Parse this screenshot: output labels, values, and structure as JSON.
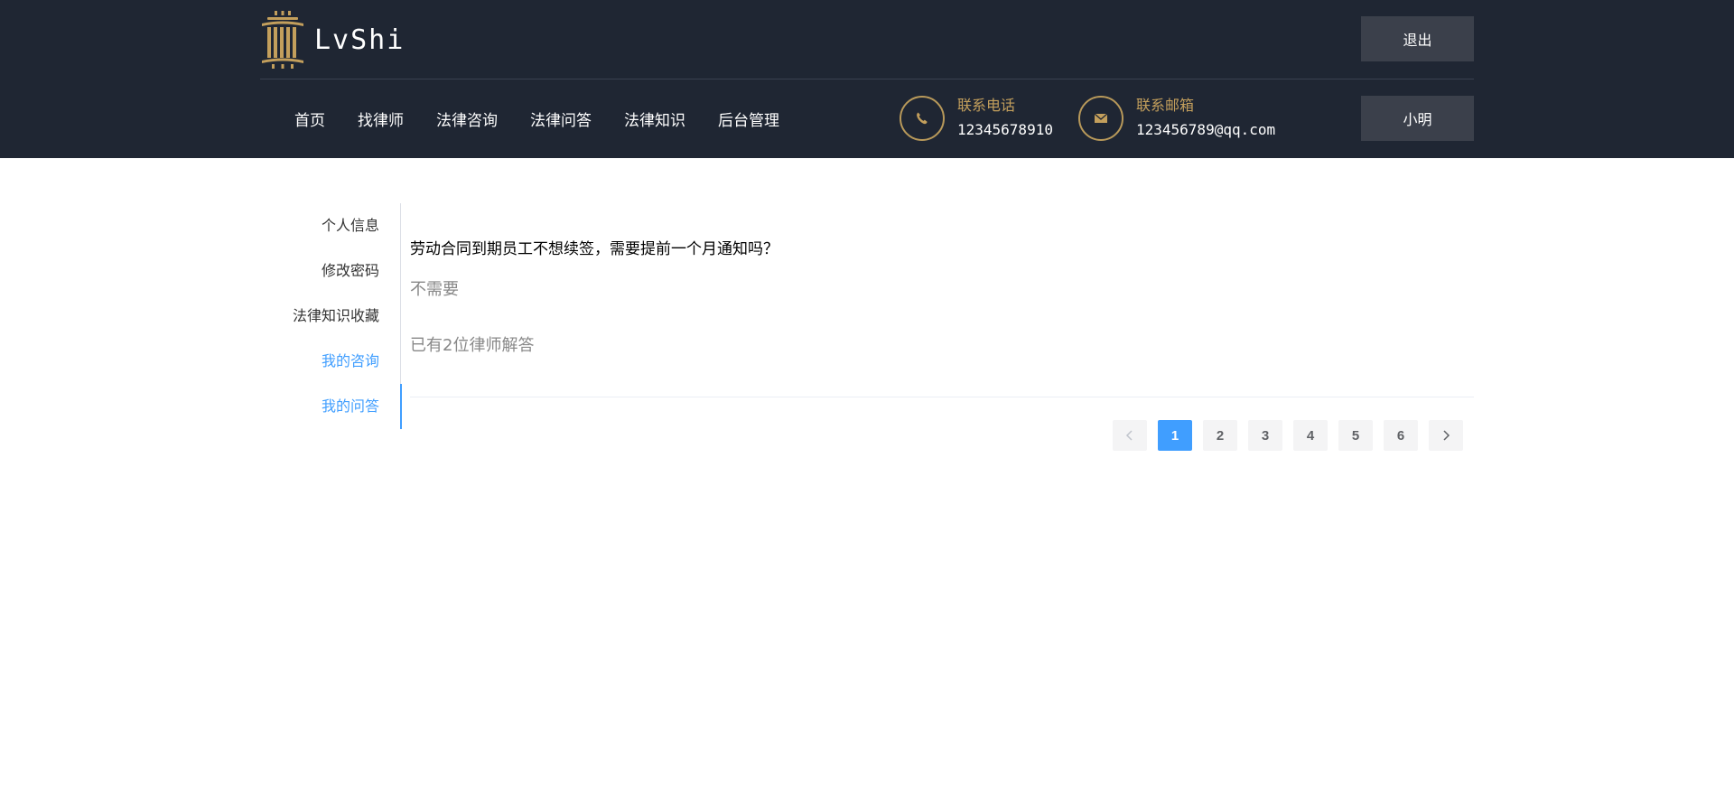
{
  "header": {
    "logo_text": "LvShi",
    "logout_label": "退出",
    "user_label": "小明",
    "nav": [
      "首页",
      "找律师",
      "法律咨询",
      "法律问答",
      "法律知识",
      "后台管理"
    ],
    "phone": {
      "label": "联系电话",
      "value": "12345678910",
      "icon": "phone-icon"
    },
    "email": {
      "label": "联系邮箱",
      "value": "123456789@qq.com",
      "icon": "mail-icon"
    },
    "colors": {
      "bg": "#1f2633",
      "gold": "#c39f5c"
    }
  },
  "sidebar": {
    "items": [
      {
        "label": "个人信息"
      },
      {
        "label": "修改密码"
      },
      {
        "label": "法律知识收藏"
      },
      {
        "label": "我的咨询"
      },
      {
        "label": "我的问答"
      }
    ],
    "accent": "#409eff"
  },
  "main": {
    "question": "劳动合同到期员工不想续签，需要提前一个月通知吗？",
    "answer": "不需要",
    "answer_count": "已有2位律师解答"
  },
  "pagination": {
    "pages": [
      "1",
      "2",
      "3",
      "4",
      "5",
      "6"
    ],
    "current": "1",
    "prev_icon": "chevron-left-icon",
    "next_icon": "chevron-right-icon"
  }
}
